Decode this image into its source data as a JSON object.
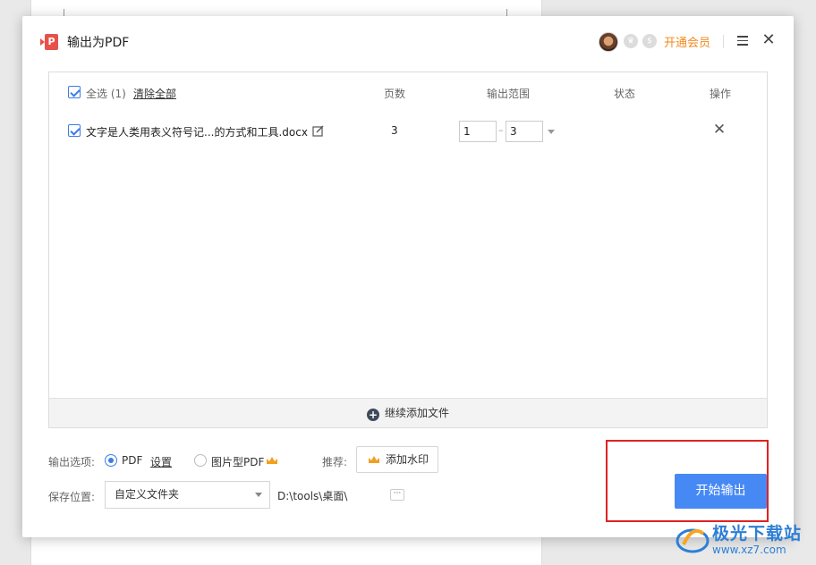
{
  "dialog": {
    "title": "输出为PDF",
    "vip_link": "开通会员",
    "badge_crown": "♛",
    "badge_s": "$"
  },
  "file_list": {
    "select_all": "全选 (1)",
    "clear_all": "清除全部",
    "columns": {
      "pages": "页数",
      "range": "输出范围",
      "status": "状态",
      "actions": "操作"
    },
    "rows": [
      {
        "filename": "文字是人类用表义符号记...的方式和工具.docx",
        "pages": "3",
        "range_from": "1",
        "range_to": "3",
        "checked": true
      }
    ],
    "add_more": "继续添加文件"
  },
  "options": {
    "label": "输出选项:",
    "pdf": "PDF",
    "settings": "设置",
    "image_pdf": "图片型PDF",
    "selected": "PDF",
    "recommend_label": "推荐:",
    "watermark_button": "添加水印"
  },
  "save": {
    "label": "保存位置:",
    "location": "自定义文件夹",
    "path": "D:\\tools\\桌面\\",
    "browse": "···"
  },
  "start_button": "开始输出",
  "watermark": {
    "name": "极光下载站",
    "url": "www.xz7.com"
  },
  "colors": {
    "accent": "#4689f5",
    "vip": "#f08a1c",
    "highlight": "#e02222"
  }
}
